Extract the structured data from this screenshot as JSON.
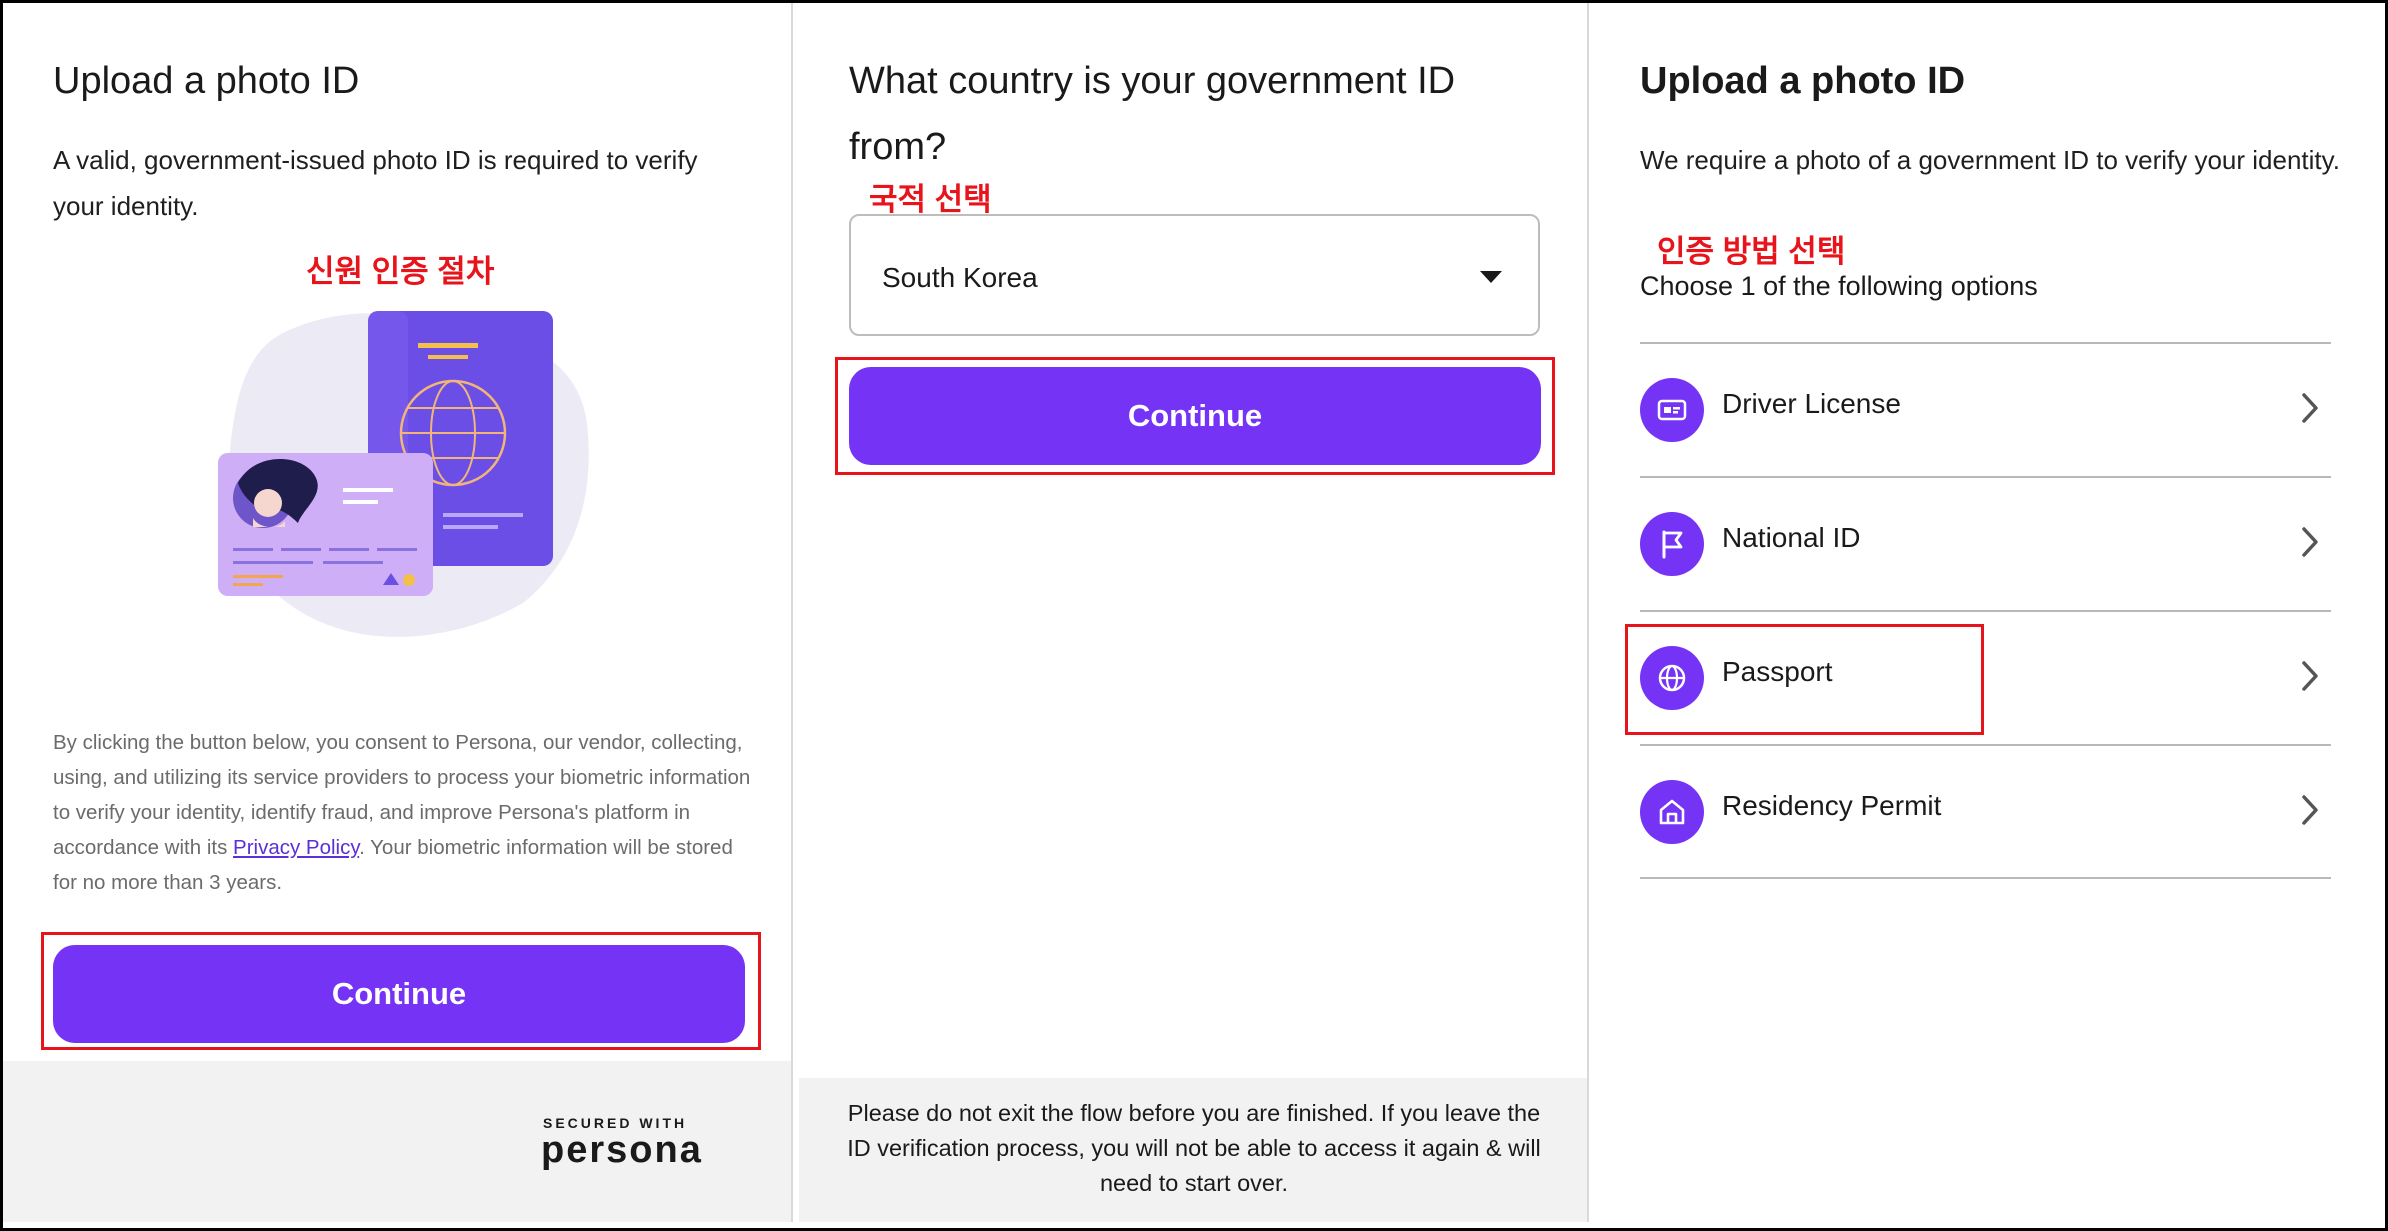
{
  "panel1": {
    "title": "Upload a photo ID",
    "description": "A valid, government-issued photo ID is required to verify your identity.",
    "annotation": "신원 인증 절차",
    "consent_before": "By clicking the button below, you consent to Persona, our vendor, collecting, using, and utilizing its service providers to process your biometric information to verify your identity, identify fraud, and improve Persona's platform in accordance with its ",
    "privacy_link": "Privacy Policy",
    "consent_after": ". Your biometric information will be stored for no more than 3 years.",
    "continue_label": "Continue",
    "footer": {
      "secured_with": "SECURED WITH",
      "brand": "persona"
    }
  },
  "panel2": {
    "title": "What country is your government ID from?",
    "annotation": "국적 선택",
    "country_select": {
      "value": "South Korea"
    },
    "continue_label": "Continue",
    "footer_notice": "Please do not exit the flow before you are finished. If you leave the ID verification process, you will not be able to access it again & will need to start over."
  },
  "panel3": {
    "title": "Upload a photo ID",
    "description": "We require a photo of a government ID to verify your identity.",
    "annotation": "인증 방법 선택",
    "choose_text": "Choose 1 of the following options",
    "options": [
      {
        "label": "Driver License",
        "icon": "id-card-icon"
      },
      {
        "label": "National ID",
        "icon": "flag-icon"
      },
      {
        "label": "Passport",
        "icon": "globe-icon"
      },
      {
        "label": "Residency Permit",
        "icon": "home-icon"
      }
    ]
  },
  "colors": {
    "accent": "#7533f5",
    "annotation": "#e8141b",
    "footer_bg": "#f2f2f2"
  }
}
